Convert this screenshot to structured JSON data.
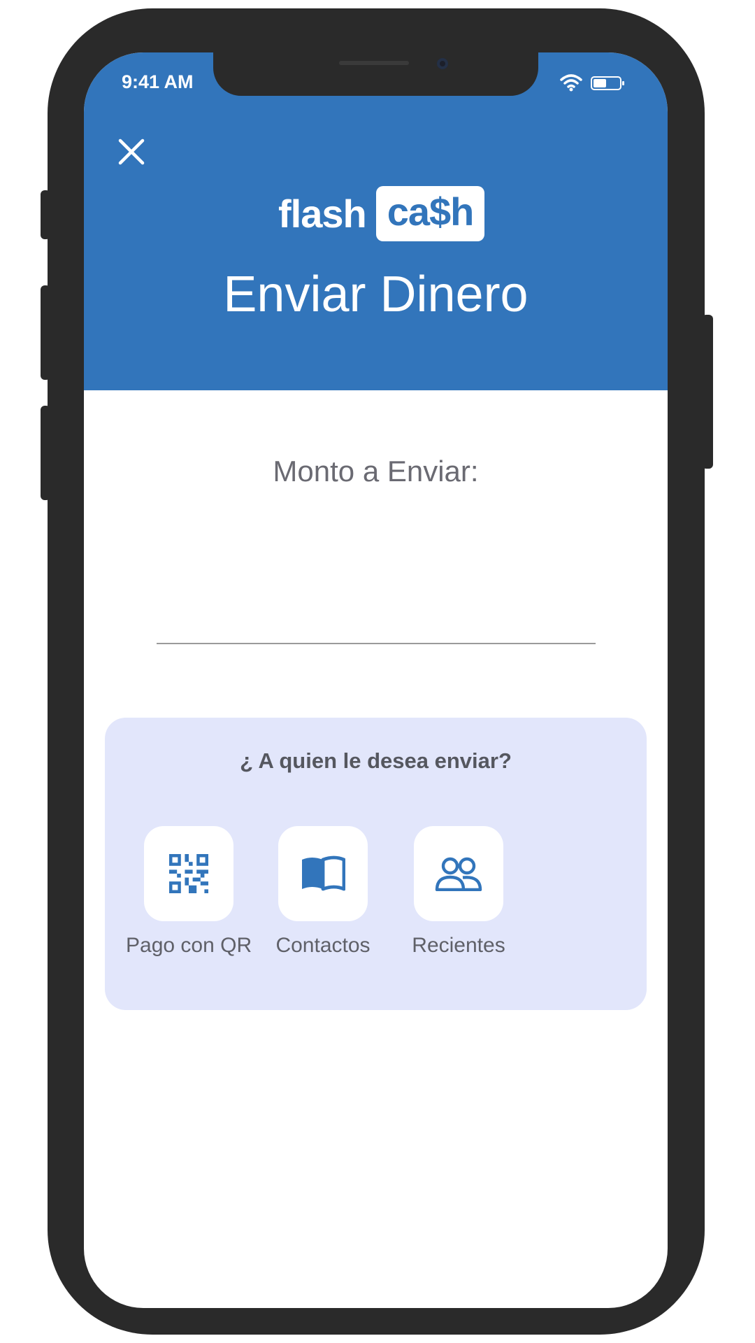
{
  "status_bar": {
    "time": "9:41 AM"
  },
  "header": {
    "brand_left": "flash",
    "brand_right": "ca$h",
    "title": "Enviar Dinero",
    "accent": "#3275bb"
  },
  "amount": {
    "label": "Monto a Enviar:",
    "value": ""
  },
  "recipients": {
    "question": "¿ A quien le desea enviar?",
    "options": [
      {
        "label": "Pago con QR",
        "icon": "qr-code-icon"
      },
      {
        "label": "Contactos",
        "icon": "book-icon"
      },
      {
        "label": "Recientes",
        "icon": "people-icon"
      }
    ],
    "panel_bg": "#e2e6fb"
  }
}
